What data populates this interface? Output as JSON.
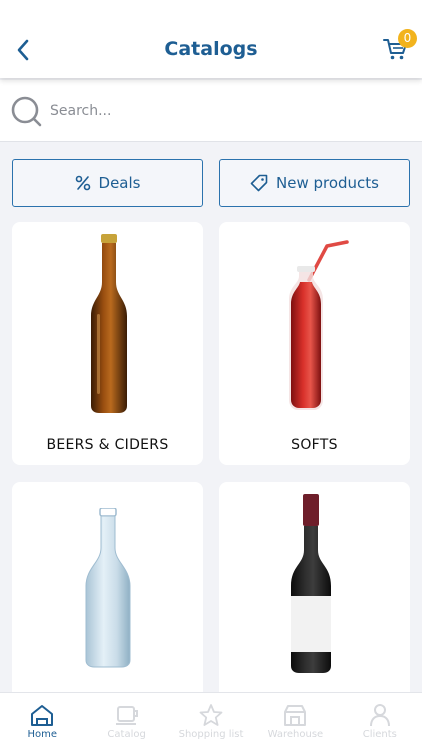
{
  "header": {
    "title": "Catalogs",
    "back_icon": "chevron-left-icon",
    "cart_icon": "shopping-cart-icon",
    "cart_count": "0"
  },
  "search": {
    "placeholder": "Search...",
    "value": "",
    "icon": "search-icon"
  },
  "filters": [
    {
      "label": "Deals",
      "icon": "percent-icon"
    },
    {
      "label": "New products",
      "icon": "tag-icon"
    }
  ],
  "categories": [
    {
      "label": "BEERS & CIDERS",
      "image": "beer-bottle"
    },
    {
      "label": "SOFTS",
      "image": "soda-bottle-with-straw"
    },
    {
      "label": "",
      "image": "water-bottle"
    },
    {
      "label": "",
      "image": "wine-bottle"
    }
  ],
  "tabbar": {
    "tabs": [
      {
        "label": "Home",
        "icon": "home-icon",
        "active": true
      },
      {
        "label": "Catalog",
        "icon": "catalog-icon",
        "active": false
      },
      {
        "label": "Shopping list",
        "icon": "star-icon",
        "active": false
      },
      {
        "label": "Warehouse",
        "icon": "warehouse-icon",
        "active": false
      },
      {
        "label": "Clients",
        "icon": "user-icon",
        "active": false
      }
    ]
  },
  "colors": {
    "primary": "#1e5e93",
    "badge": "#f2b31d",
    "background": "#f2f3f7",
    "inactive_tab": "#d6d8dc"
  }
}
